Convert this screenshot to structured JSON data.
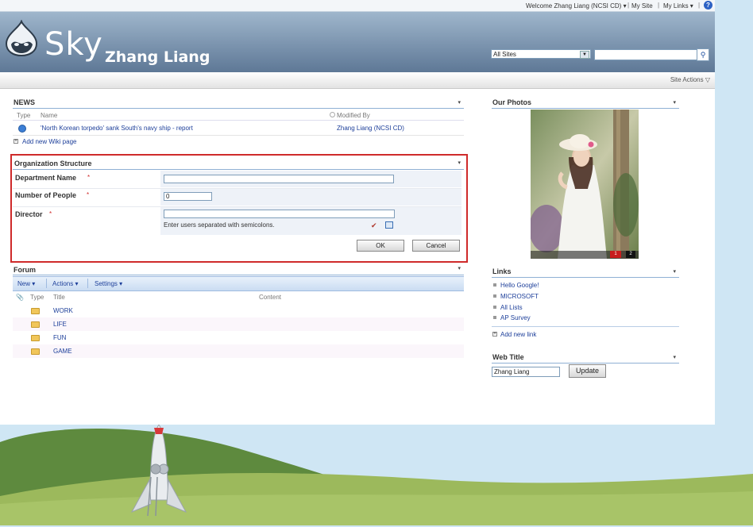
{
  "topbar": {
    "welcome": "Welcome Zhang Liang (NCSI CD) ▾",
    "my_site": "My Site",
    "my_links": "My Links ▾",
    "help_icon": "help-icon"
  },
  "header": {
    "site_title": "Sky",
    "user_title": "Zhang Liang",
    "search_scope": "All Sites",
    "search_placeholder": "",
    "logo_icon": "drupal-drop-logo"
  },
  "site_actions": "Site Actions ▽",
  "news": {
    "title": "NEWS",
    "col_type": "Type",
    "col_name": "Name",
    "col_modified": "Modified By",
    "items": [
      {
        "name": "'North Korean torpedo' sank South's navy ship - report",
        "modified_by": "Zhang Liang (NCSI CD)"
      }
    ],
    "add_link": "Add new Wiki page"
  },
  "org": {
    "title": "Organization Structure",
    "dept_label": "Department Name",
    "people_label": "Number of People",
    "people_value": "0",
    "director_label": "Director",
    "director_hint": "Enter users separated with semicolons.",
    "ok": "OK",
    "cancel": "Cancel",
    "required_mark": "*"
  },
  "forum": {
    "title": "Forum",
    "toolbar": [
      "New ▾",
      "Actions ▾",
      "Settings ▾"
    ],
    "col_type": "Type",
    "col_title": "Title",
    "col_content": "Content",
    "items": [
      "WORK",
      "LIFE",
      "FUN",
      "GAME"
    ]
  },
  "photos": {
    "title": "Our Photos",
    "pager": [
      "1",
      "2"
    ]
  },
  "links": {
    "title": "Links",
    "items": [
      "Hello Google!",
      "MICROSOFT",
      "All Lists",
      "AP Survey"
    ],
    "add_link": "Add new link"
  },
  "web_title": {
    "title": "Web Title",
    "value": "Zhang Liang",
    "update": "Update"
  },
  "colors": {
    "header_top": "#9fb6cc",
    "header_bottom": "#5e7896",
    "highlight_border": "#cf2b2b",
    "link": "#1d3f9a"
  }
}
